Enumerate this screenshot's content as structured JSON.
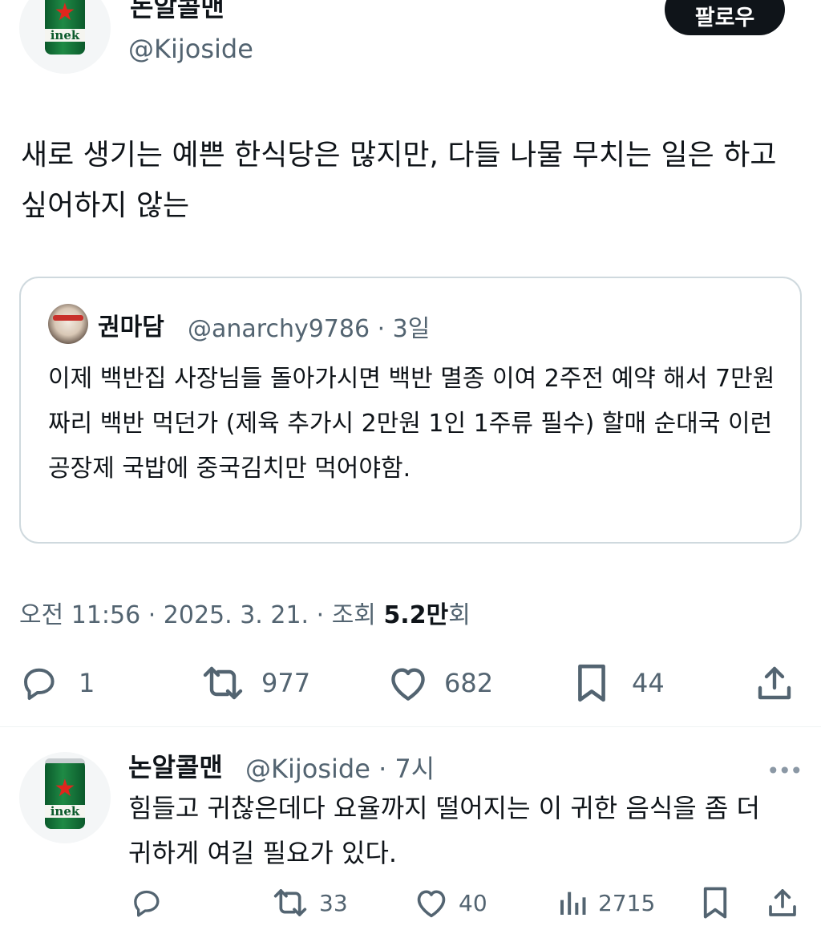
{
  "main_tweet": {
    "author_name": "논알콜맨",
    "author_handle": "@Kijoside",
    "follow_label": "팔로우",
    "text": "새로 생기는 예쁜 한식당은 많지만, 다들 나물 무치는 일은 하고싶어하지 않는",
    "quote": {
      "author_name": "권마담",
      "author_handle_time": "@anarchy9786 · 3일",
      "text": "이제 백반집 사장님들 돌아가시면 백반 멸종 이여 2주전 예약 해서 7만원 짜리 백반 먹던가 (제육 추가시 2만원 1인 1주류 필수) 할매 순대국 이런 공장제 국밥에 중국김치만 먹어야함."
    },
    "timestamp": "오전 11:56 · 2025. 3. 21. · 조회 ",
    "views_count": "5.2만",
    "views_suffix": "회",
    "replies": "1",
    "retweets": "977",
    "likes": "682",
    "bookmarks": "44"
  },
  "reply_tweet": {
    "author_name": "논알콜맨",
    "author_handle_time": "@Kijoside · 7시",
    "text": "힘들고 귀찮은데다 요율까지 떨어지는 이 귀한 음식을 좀 더 귀하게 여길 필요가 있다.",
    "retweets": "33",
    "likes": "40",
    "views": "2715"
  },
  "avatar_brand_text": "inek",
  "colors": {
    "text": "#0f1419",
    "secondary": "#536471",
    "border": "#cfd9de"
  },
  "icons": [
    "reply-icon",
    "retweet-icon",
    "like-icon",
    "bookmark-icon",
    "share-icon",
    "views-icon",
    "more-icon"
  ]
}
